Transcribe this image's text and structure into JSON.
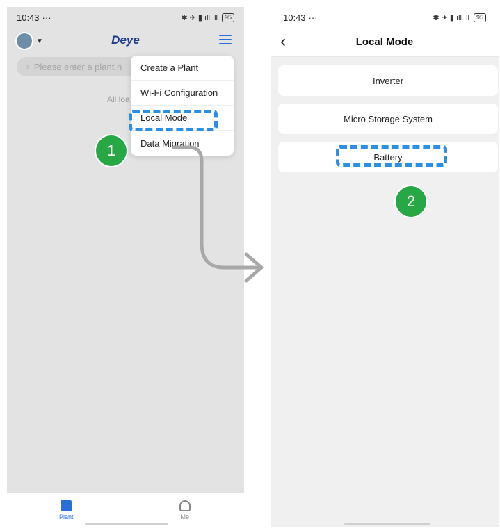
{
  "left_screen": {
    "status": {
      "time": "10:43",
      "dots": "···",
      "battery": "95"
    },
    "header": {
      "brand": "Deye"
    },
    "search": {
      "placeholder": "Please enter a plant n"
    },
    "list_status": "All loa",
    "dropdown": {
      "items": [
        {
          "label": "Create a Plant"
        },
        {
          "label": "Wi-Fi Configuration"
        },
        {
          "label": "Local Mode"
        },
        {
          "label": "Data Migration"
        }
      ]
    },
    "step_badge": "1",
    "bottom_nav": {
      "plant_label": "Plant",
      "me_label": "Me"
    }
  },
  "right_screen": {
    "status": {
      "time": "10:43",
      "dots": "···",
      "battery": "95"
    },
    "title": "Local Mode",
    "options": [
      {
        "label": "Inverter"
      },
      {
        "label": "Micro Storage System"
      },
      {
        "label": "Battery"
      }
    ],
    "step_badge": "2"
  },
  "colors": {
    "highlight": "#2c8fe6",
    "badge": "#27a844",
    "brand": "#1d3a8a",
    "accent": "#2a6fd8"
  },
  "icons": [
    "avatar-icon",
    "menu-icon",
    "search-icon",
    "back-icon",
    "plant-icon",
    "me-icon",
    "flow-arrow-icon"
  ]
}
